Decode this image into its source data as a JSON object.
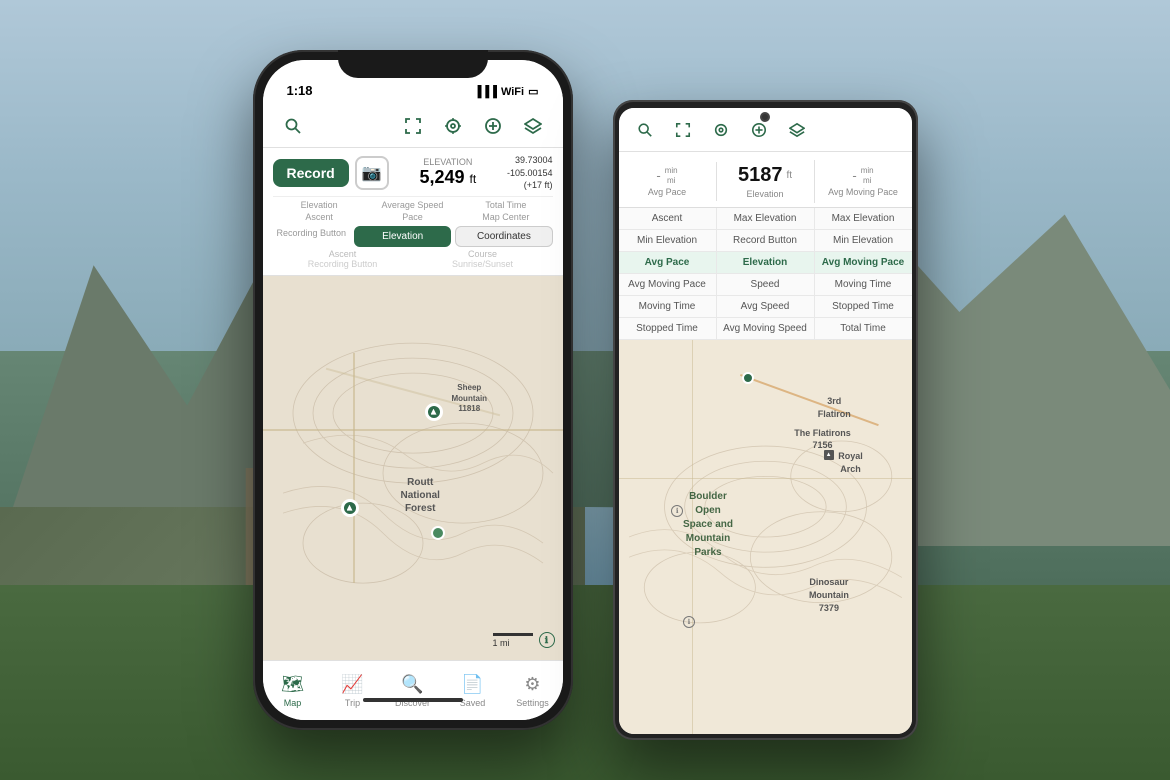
{
  "background": {
    "description": "Mountain lake landscape background"
  },
  "iphone": {
    "status_time": "1:18",
    "toolbar_icons": [
      "search",
      "expand",
      "location",
      "plus",
      "layers"
    ],
    "record_btn": "Record",
    "elevation_label": "Elevation",
    "elevation_value": "5,249",
    "elevation_unit": "ft",
    "coords": "39.73004\n-105.00154\n(+17 ft)",
    "stats": [
      {
        "label": "Elevation",
        "value": ""
      },
      {
        "label": "Average Speed",
        "value": ""
      },
      {
        "label": "Total Time",
        "value": ""
      },
      {
        "label": "Ascent",
        "value": ""
      },
      {
        "label": "Pace",
        "value": ""
      },
      {
        "label": "Map Center",
        "value": ""
      },
      {
        "label": "Recording Button",
        "value": ""
      },
      {
        "label": "Elevation",
        "value": ""
      },
      {
        "label": "Coordinates",
        "value": ""
      },
      {
        "label": "Ascent",
        "value": ""
      },
      {
        "label": "Course",
        "value": ""
      },
      {
        "label": "Recording Button",
        "value": ""
      },
      {
        "label": "Sunrise/Sunset",
        "value": ""
      }
    ],
    "data_buttons": [
      {
        "label": "Elevation",
        "active": true
      },
      {
        "label": "Coordinates",
        "active": true
      }
    ],
    "map_labels": [
      {
        "text": "Sheep\nMountain\n11818",
        "top": "30%",
        "left": "68%"
      },
      {
        "text": "Routt\nNational\nForest",
        "top": "55%",
        "left": "52%"
      }
    ],
    "scale_label": "1 mi",
    "bottom_nav": [
      {
        "label": "Map",
        "icon": "🗺",
        "active": true
      },
      {
        "label": "Trip",
        "icon": "📈",
        "active": false
      },
      {
        "label": "Discover",
        "icon": "🔍",
        "active": false
      },
      {
        "label": "Saved",
        "icon": "📄",
        "active": false
      },
      {
        "label": "Settings",
        "icon": "⚙",
        "active": false
      }
    ]
  },
  "android": {
    "toolbar_icons": [
      "search",
      "expand",
      "location",
      "plus",
      "layers"
    ],
    "stats_header": [
      {
        "value": "-",
        "unit": "min\nmi",
        "label": "Avg Pace"
      },
      {
        "value": "5187",
        "unit": "ft",
        "label": "Elevation"
      },
      {
        "value": "-",
        "unit": "min\nmi",
        "label": "Avg Moving Pace"
      }
    ],
    "selector_rows": [
      [
        {
          "label": "Ascent",
          "active": false
        },
        {
          "label": "Max Elevation",
          "active": false
        },
        {
          "label": "Max Elevation",
          "active": false
        }
      ],
      [
        {
          "label": "Min Elevation",
          "active": false
        },
        {
          "label": "Record Button",
          "active": false
        },
        {
          "label": "Min Elevation",
          "active": false
        }
      ],
      [
        {
          "label": "Avg Pace",
          "active": true
        },
        {
          "label": "Elevation",
          "active": true
        },
        {
          "label": "Avg Moving Pace",
          "active": true
        }
      ],
      [
        {
          "label": "Avg Moving Pace",
          "active": false
        },
        {
          "label": "Speed",
          "active": false
        },
        {
          "label": "Moving Time",
          "active": false
        }
      ],
      [
        {
          "label": "Moving Time",
          "active": false
        },
        {
          "label": "Avg Speed",
          "active": false
        },
        {
          "label": "Stopped Time",
          "active": false
        }
      ],
      [
        {
          "label": "Stopped Time",
          "active": false
        },
        {
          "label": "Avg Moving Speed",
          "active": false
        },
        {
          "label": "Total Time",
          "active": false
        }
      ]
    ],
    "map_labels": [
      {
        "text": "Boulder\nOpen\nSpace and\nMountain\nParks",
        "top": "45%",
        "left": "30%"
      },
      {
        "text": "3rd\nFlatiron",
        "top": "20%",
        "left": "72%"
      },
      {
        "text": "The Flatirons\n7156",
        "top": "28%",
        "left": "65%"
      },
      {
        "text": "Royal\nArch",
        "top": "32%",
        "left": "78%"
      },
      {
        "text": "Dinosaur\nMountain\n7379",
        "top": "65%",
        "left": "70%"
      }
    ]
  }
}
